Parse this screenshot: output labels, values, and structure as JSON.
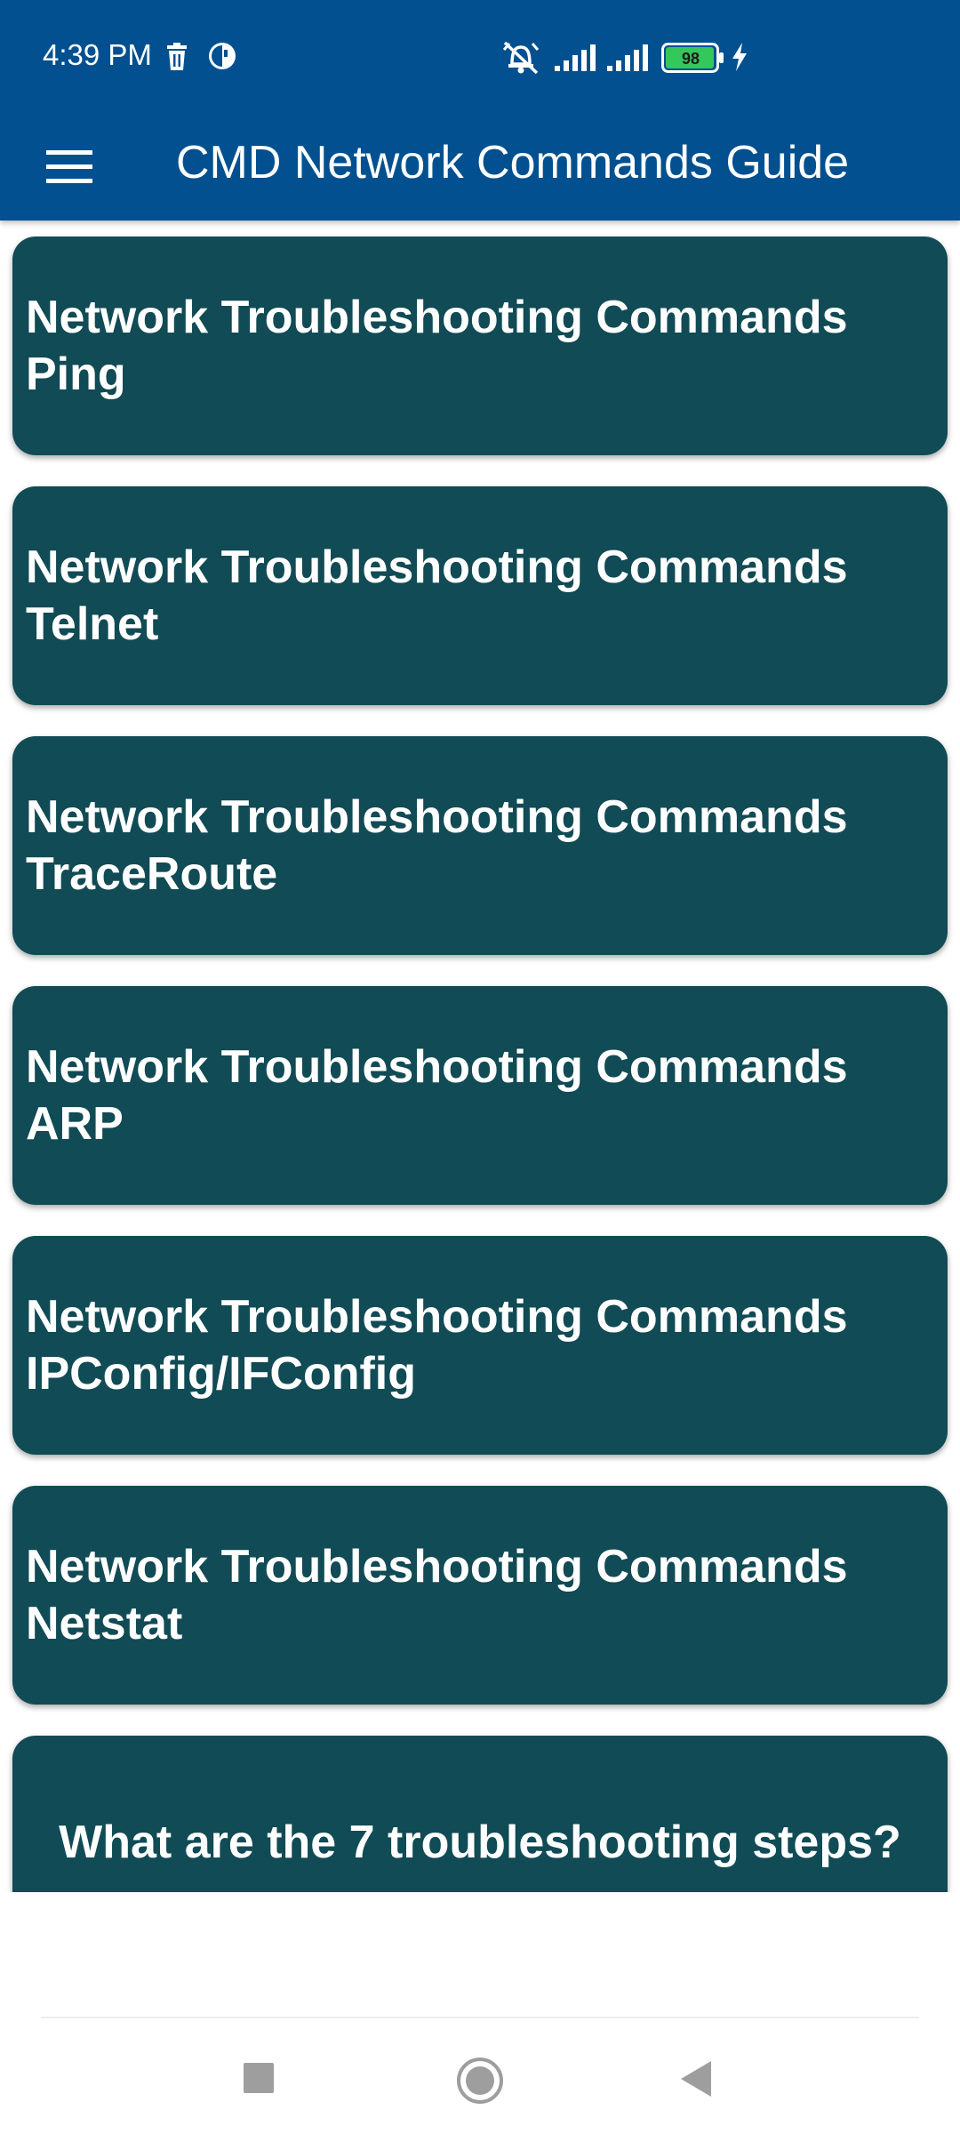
{
  "status_bar": {
    "time": "4:39 PM",
    "battery_level": "98",
    "icons": [
      "trash-icon",
      "vpn-icon",
      "alarm-off-icon",
      "signal-icon",
      "signal-icon",
      "battery-icon",
      "charging-icon"
    ]
  },
  "app_bar": {
    "title": "CMD Network Commands Guide",
    "menu_icon": "hamburger-menu-icon",
    "background_color": "#02508f"
  },
  "cards": [
    {
      "line1": "Network Troubleshooting Commands",
      "line2": "Ping"
    },
    {
      "line1": "Network Troubleshooting Commands",
      "line2": "Telnet"
    },
    {
      "line1": "Network Troubleshooting Commands",
      "line2": "TraceRoute"
    },
    {
      "line1": "Network Troubleshooting Commands",
      "line2": "ARP"
    },
    {
      "line1": "Network Troubleshooting Commands",
      "line2": "IPConfig/IFConfig"
    },
    {
      "line1": "Network Troubleshooting Commands",
      "line2": "Netstat"
    }
  ],
  "faq_card": {
    "title": "What are the 7 troubleshooting steps?"
  },
  "card_color": "#114b55",
  "nav_bar": {
    "buttons": [
      "recents-square-icon",
      "home-circle-icon",
      "back-triangle-icon"
    ]
  }
}
